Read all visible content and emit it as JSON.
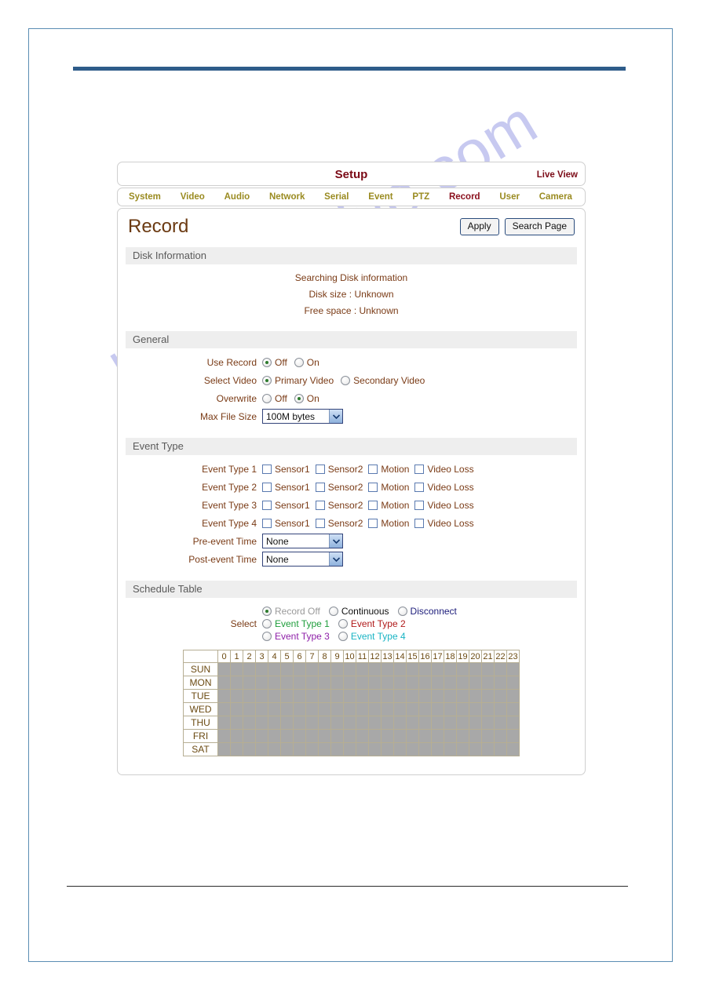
{
  "watermark": "manualshive.com",
  "header": {
    "setup_title": "Setup",
    "live_view": "Live View"
  },
  "tabs": [
    {
      "label": "System",
      "active": false
    },
    {
      "label": "Video",
      "active": false
    },
    {
      "label": "Audio",
      "active": false
    },
    {
      "label": "Network",
      "active": false
    },
    {
      "label": "Serial",
      "active": false
    },
    {
      "label": "Event",
      "active": false
    },
    {
      "label": "PTZ",
      "active": false
    },
    {
      "label": "Record",
      "active": true
    },
    {
      "label": "User",
      "active": false
    },
    {
      "label": "Camera",
      "active": false
    }
  ],
  "page": {
    "title": "Record",
    "apply_label": "Apply",
    "search_page_label": "Search Page"
  },
  "disk_information": {
    "section_title": "Disk Information",
    "line1": "Searching Disk information",
    "line2": "Disk size : Unknown",
    "line3": "Free space : Unknown"
  },
  "general": {
    "section_title": "General",
    "use_record": {
      "label": "Use Record",
      "options": [
        "Off",
        "On"
      ],
      "selected": "Off"
    },
    "select_video": {
      "label": "Select Video",
      "options": [
        "Primary Video",
        "Secondary Video"
      ],
      "selected": "Primary Video"
    },
    "overwrite": {
      "label": "Overwrite",
      "options": [
        "Off",
        "On"
      ],
      "selected": "On"
    },
    "max_file_size": {
      "label": "Max File Size",
      "value": "100M bytes"
    }
  },
  "event_type": {
    "section_title": "Event Type",
    "checkbox_labels": [
      "Sensor1",
      "Sensor2",
      "Motion",
      "Video Loss"
    ],
    "rows": [
      {
        "label": "Event Type 1",
        "checked": [
          false,
          false,
          false,
          false
        ]
      },
      {
        "label": "Event Type 2",
        "checked": [
          false,
          false,
          false,
          false
        ]
      },
      {
        "label": "Event Type 3",
        "checked": [
          false,
          false,
          false,
          false
        ]
      },
      {
        "label": "Event Type 4",
        "checked": [
          false,
          false,
          false,
          false
        ]
      }
    ],
    "pre_event_time": {
      "label": "Pre-event Time",
      "value": "None"
    },
    "post_event_time": {
      "label": "Post-event Time",
      "value": "None"
    }
  },
  "schedule_table": {
    "section_title": "Schedule Table",
    "select_label": "Select",
    "options": [
      {
        "label": "Record Off",
        "color": "#9a9a9a",
        "selected": true
      },
      {
        "label": "Continuous",
        "color": "#111111",
        "selected": false
      },
      {
        "label": "Disconnect",
        "color": "#1b1b7a",
        "selected": false
      },
      {
        "label": "Event Type 1",
        "color": "#1f9e3c",
        "selected": false
      },
      {
        "label": "Event Type 2",
        "color": "#b01a1a",
        "selected": false
      },
      {
        "label": "Event Type 3",
        "color": "#8e1fa8",
        "selected": false
      },
      {
        "label": "Event Type 4",
        "color": "#19b4c4",
        "selected": false
      }
    ],
    "hours": [
      "0",
      "1",
      "2",
      "3",
      "4",
      "5",
      "6",
      "7",
      "8",
      "9",
      "10",
      "11",
      "12",
      "13",
      "14",
      "15",
      "16",
      "17",
      "18",
      "19",
      "20",
      "21",
      "22",
      "23"
    ],
    "days": [
      "SUN",
      "MON",
      "TUE",
      "WED",
      "THU",
      "FRI",
      "SAT"
    ],
    "cell_state": "record-off",
    "cell_color": "#a8a8a8"
  }
}
